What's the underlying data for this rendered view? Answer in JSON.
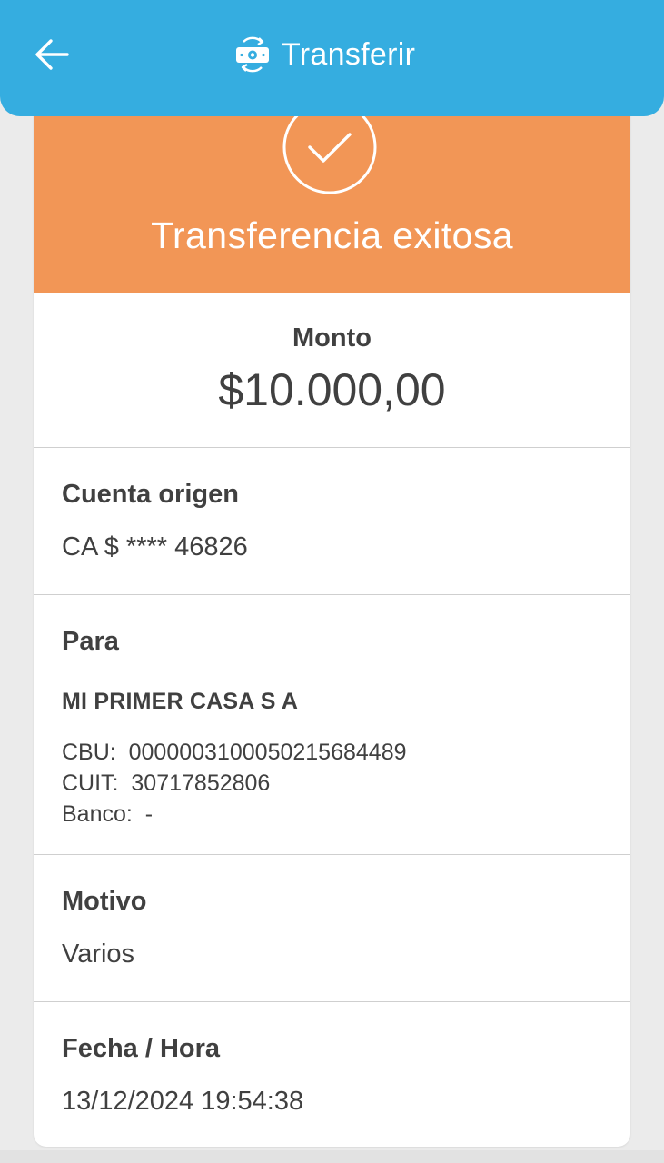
{
  "header": {
    "title": "Transferir",
    "back_icon": "arrow-left-icon",
    "title_icon": "money-transfer-icon",
    "background_color": "#35ade0"
  },
  "banner": {
    "title": "Transferencia exitosa",
    "icon": "check-circle-icon",
    "background_color": "#f29656"
  },
  "amount": {
    "label": "Monto",
    "value": "$10.000,00"
  },
  "origin_account": {
    "label": "Cuenta origen",
    "value": "CA $ **** 46826"
  },
  "recipient": {
    "label": "Para",
    "name": "MI PRIMER CASA S A",
    "cbu": "CBU:  0000003100050215684489",
    "cuit": "CUIT:  30717852806",
    "bank": "Banco:  -"
  },
  "reason": {
    "label": "Motivo",
    "value": "Varios"
  },
  "datetime": {
    "label": "Fecha / Hora",
    "value": "13/12/2024 19:54:38"
  }
}
